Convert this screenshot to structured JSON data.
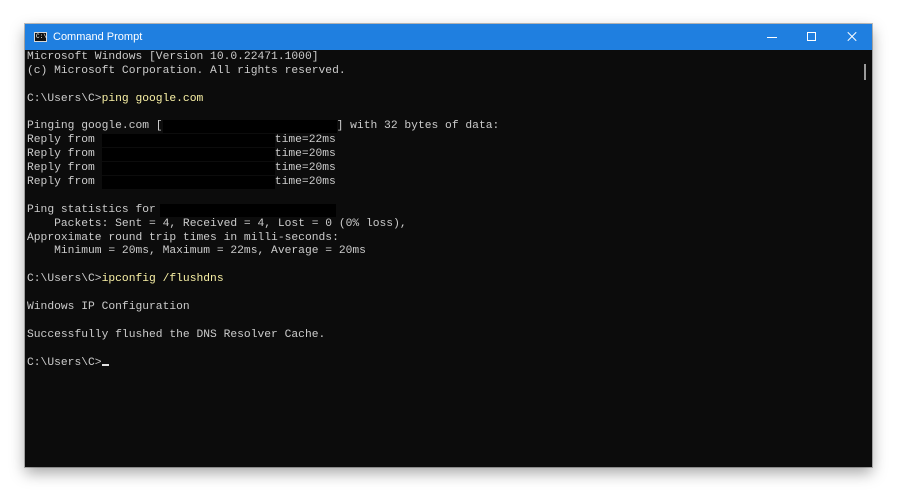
{
  "window": {
    "title": "Command Prompt",
    "icon": "command-prompt-icon",
    "controls": [
      "minimize-icon",
      "maximize-icon",
      "close-icon"
    ]
  },
  "colors": {
    "titlebar": "#1f7fe0",
    "console_background": "#0c0c0c",
    "console_text": "#cccccc",
    "command_text": "#f9f1a5"
  },
  "console": {
    "header_line1": "Microsoft Windows [Version 10.0.22471.1000]",
    "header_line2": "(c) Microsoft Corporation. All rights reserved.",
    "prompt": "C:\\Users\\C>",
    "command1": "ping google.com",
    "pinging_prefix": "Pinging google.com [",
    "pinging_suffix": "] with 32 bytes of data:",
    "replies": [
      {
        "label": "Reply from",
        "time": "time=22ms"
      },
      {
        "label": "Reply from",
        "time": "time=20ms"
      },
      {
        "label": "Reply from",
        "time": "time=20ms"
      },
      {
        "label": "Reply from",
        "time": "time=20ms"
      }
    ],
    "stats_header": "Ping statistics for",
    "stats_packets": "    Packets: Sent = 4, Received = 4, Lost = 0 (0% loss),",
    "stats_rtt_header": "Approximate round trip times in milli-seconds:",
    "stats_rtt": "    Minimum = 20ms, Maximum = 22ms, Average = 20ms",
    "command2": "ipconfig /flushdns",
    "ipconfig_header": "Windows IP Configuration",
    "flush_result": "Successfully flushed the DNS Resolver Cache."
  }
}
